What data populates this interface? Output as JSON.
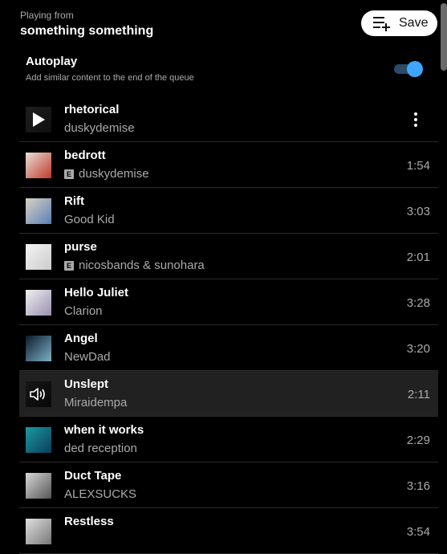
{
  "header": {
    "playing_from": "Playing from",
    "playlist_name": "something something"
  },
  "save_button": {
    "label": "Save",
    "icon": "playlist-add-icon"
  },
  "autoplay": {
    "title": "Autoplay",
    "description": "Add similar content to the end of the queue",
    "enabled": true,
    "accent": "#3ea6ff"
  },
  "queue": [
    {
      "title": "rhetorical",
      "artist": "duskydemise",
      "explicit": false,
      "duration": "",
      "state": "play-overlay",
      "thumb_colors": [
        "#444",
        "#222"
      ]
    },
    {
      "title": "bedrott",
      "artist": "duskydemise",
      "explicit": true,
      "duration": "1:54",
      "state": "",
      "thumb_colors": [
        "#e8e0d8",
        "#c0392b"
      ]
    },
    {
      "title": "Rift",
      "artist": "Good Kid",
      "explicit": false,
      "duration": "3:03",
      "state": "",
      "thumb_colors": [
        "#d9d2c5",
        "#5a7fb5"
      ]
    },
    {
      "title": "purse",
      "artist": "nicosbands & sunohara",
      "explicit": true,
      "duration": "2:01",
      "state": "",
      "thumb_colors": [
        "#f4f4f4",
        "#cccccc"
      ]
    },
    {
      "title": "Hello Juliet",
      "artist": "Clarion",
      "explicit": false,
      "duration": "3:28",
      "state": "",
      "thumb_colors": [
        "#f0f0f0",
        "#9a8fb0"
      ]
    },
    {
      "title": "Angel",
      "artist": "NewDad",
      "explicit": false,
      "duration": "3:20",
      "state": "",
      "thumb_colors": [
        "#0b1a2a",
        "#7fb0c8"
      ]
    },
    {
      "title": "Unslept",
      "artist": "Miraidempa",
      "explicit": false,
      "duration": "2:11",
      "state": "now-playing",
      "thumb_colors": [
        "#333",
        "#111"
      ]
    },
    {
      "title": "when it works",
      "artist": "ded reception",
      "explicit": false,
      "duration": "2:29",
      "state": "",
      "thumb_colors": [
        "#1a9aa0",
        "#0b3d5c"
      ]
    },
    {
      "title": "Duct Tape",
      "artist": "ALEXSUCKS",
      "explicit": false,
      "duration": "3:16",
      "state": "",
      "thumb_colors": [
        "#d8d8d8",
        "#555555"
      ]
    },
    {
      "title": "Restless",
      "artist": "",
      "explicit": false,
      "duration": "3:54",
      "state": "",
      "thumb_colors": [
        "#e0e0e0",
        "#777777"
      ]
    }
  ]
}
